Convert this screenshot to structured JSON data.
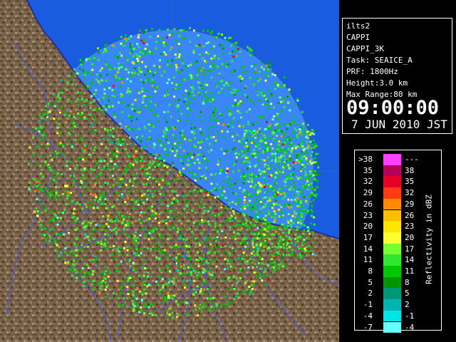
{
  "info": {
    "station": "ilts2",
    "product": "CAPPI",
    "product_detail": "CAPPI_3K",
    "task": "Task: SEAICE_A",
    "prf": "PRF: 1800Hz",
    "height": "Height:3.0 km",
    "max_range": "Max Range:80 km",
    "time": "09:00:00",
    "date": "7 JUN 2010 JST"
  },
  "legend": {
    "axis_label": "Reflectivity in dBZ",
    "rows": [
      {
        "low": ">38",
        "high": "---",
        "color": "#ff40ff"
      },
      {
        "low": "35",
        "high": "38",
        "color": "#b4005a"
      },
      {
        "low": "32",
        "high": "35",
        "color": "#e60028"
      },
      {
        "low": "29",
        "high": "32",
        "color": "#ff3c14"
      },
      {
        "low": "26",
        "high": "29",
        "color": "#ff8c00"
      },
      {
        "low": "23",
        "high": "26",
        "color": "#ffbe00"
      },
      {
        "low": "20",
        "high": "23",
        "color": "#ffe600"
      },
      {
        "low": "17",
        "high": "20",
        "color": "#ffff32"
      },
      {
        "low": "14",
        "high": "17",
        "color": "#78ff32"
      },
      {
        "low": "11",
        "high": "14",
        "color": "#32e632"
      },
      {
        "low": "8",
        "high": "11",
        "color": "#00c800"
      },
      {
        "low": "5",
        "high": "8",
        "color": "#009600"
      },
      {
        "low": "2",
        "high": "5",
        "color": "#009678"
      },
      {
        "low": "-1",
        "high": "2",
        "color": "#00b4b4"
      },
      {
        "low": "-4",
        "high": "-1",
        "color": "#00e6e6"
      },
      {
        "low": "-7",
        "high": "-4",
        "color": "#64ffff"
      }
    ]
  },
  "colors": {
    "background": "#000000",
    "sea": "#1a5ce0",
    "radar_coverage": "#3a86ff",
    "land": "#7a6248",
    "rivers": "#4a5ad8",
    "coastline": "#2030a0",
    "range_rings": "#5a6a8a"
  }
}
